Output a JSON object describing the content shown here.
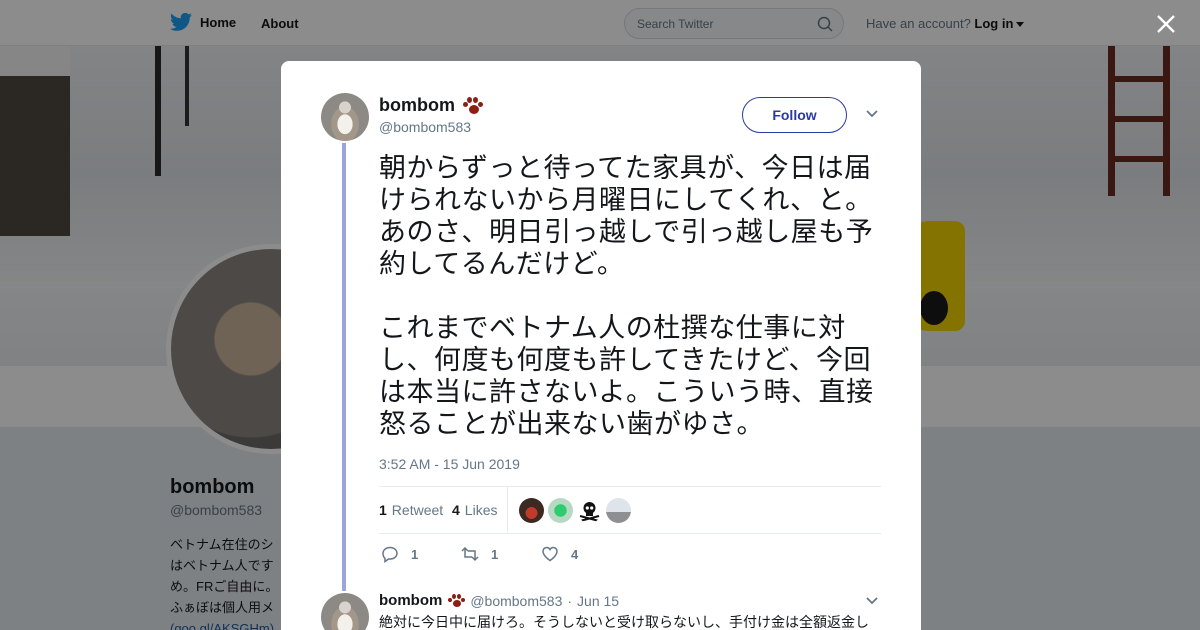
{
  "topbar": {
    "home_label": "Home",
    "about_label": "About",
    "search_placeholder": "Search Twitter",
    "account_prompt": "Have an account?",
    "login_label": "Log in"
  },
  "profile_background": {
    "name": "bombom",
    "handle": "@bombom583",
    "bio_lines": "ベトナム在住のシ\nはベトナム人です\nめ。FRご自由に。\nふぁぼは個人用メ",
    "bio_link": "(goo.gl/AKSGHm)"
  },
  "tweet": {
    "author_name": "bombom",
    "author_handle": "@bombom583",
    "follow_label": "Follow",
    "paragraph_1": "朝からずっと待ってた家具が、今日は届けられないから月曜日にしてくれ、と。あのさ、明日引っ越しで引っ越し屋も予約してるんだけど。",
    "paragraph_2": "これまでベトナム人の杜撰な仕事に対し、何度も何度も許してきたけど、今回は本当に許さないよ。こういう時、直接怒ることが出来ない歯がゆさ。",
    "timestamp": "3:52 AM - 15 Jun 2019",
    "retweet_count": "1",
    "retweet_label": "Retweet",
    "like_count": "4",
    "like_label": "Likes",
    "actions": {
      "reply_count": "1",
      "retweet_count": "1",
      "like_count": "4"
    }
  },
  "reply": {
    "author_name": "bombom",
    "author_handle": "@bombom583",
    "separator": "·",
    "date": "Jun 15",
    "text": "絶対に今日中に届けろ。そうしないと受け取らないし、手付け金は全額返金し"
  },
  "colors": {
    "accent": "#2b3a9f",
    "thread_line": "#9ba4db",
    "muted": "#657786",
    "paw": "#8b1f12"
  },
  "icons": [
    "twitter-bird-icon",
    "search-icon",
    "close-icon",
    "chevron-down-icon",
    "paw-icon",
    "reply-icon",
    "retweet-icon",
    "heart-icon"
  ]
}
